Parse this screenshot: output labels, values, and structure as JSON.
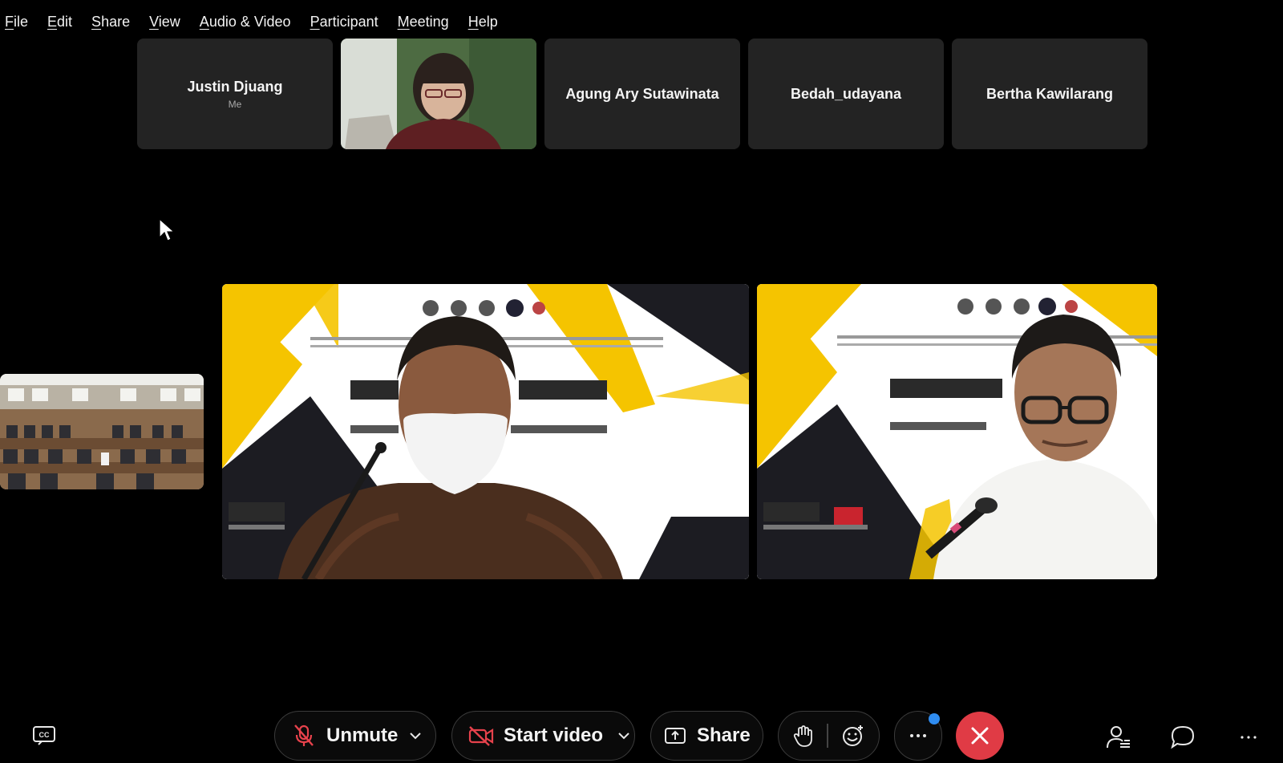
{
  "menu": [
    {
      "label": "File",
      "key": "F",
      "rest": "ile"
    },
    {
      "label": "Edit",
      "key": "E",
      "rest": "dit"
    },
    {
      "label": "Share",
      "key": "S",
      "rest": "hare"
    },
    {
      "label": "View",
      "key": "V",
      "rest": "iew"
    },
    {
      "label": "Audio & Video",
      "key": "A",
      "rest": "udio & Video"
    },
    {
      "label": "Participant",
      "key": "P",
      "rest": "articipant"
    },
    {
      "label": "Meeting",
      "key": "M",
      "rest": "eeting"
    },
    {
      "label": "Help",
      "key": "H",
      "rest": "elp"
    }
  ],
  "participants": [
    {
      "name": "Justin Djuang",
      "sub": "Me"
    },
    {
      "name": ""
    },
    {
      "name": "Agung Ary Sutawinata"
    },
    {
      "name": "Bedah_udayana"
    },
    {
      "name": "Bertha Kawilarang"
    }
  ],
  "toolbar": {
    "unmute_label": "Unmute",
    "start_video_label": "Start video",
    "share_label": "Share"
  },
  "colors": {
    "end_call": "#e03b45",
    "notification": "#2f8cf0",
    "slide_yellow": "#f5c400"
  }
}
